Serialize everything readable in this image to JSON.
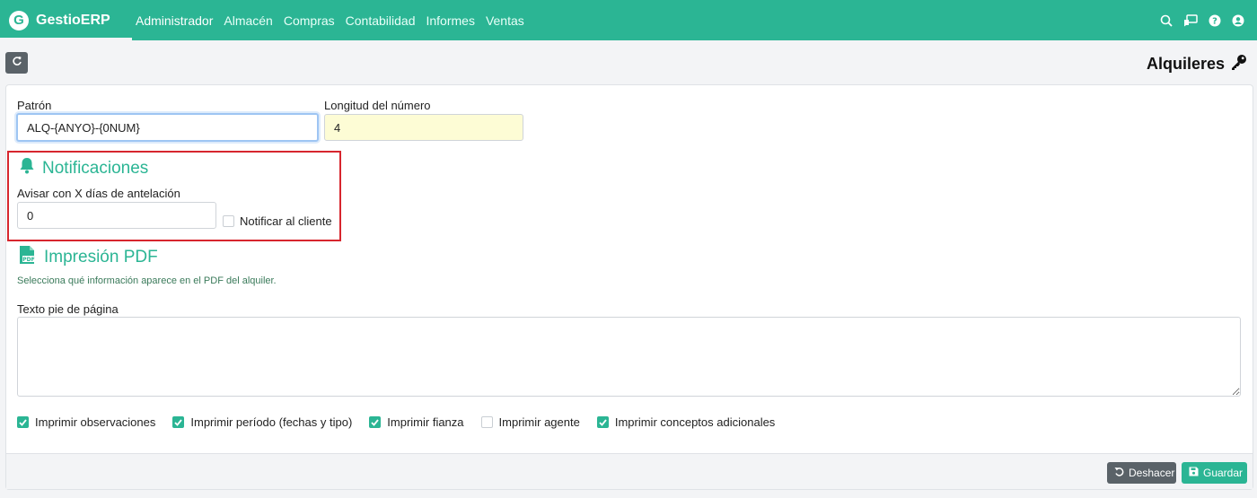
{
  "navbar": {
    "brand_initial": "G",
    "brand_name": "GestioERP",
    "menu": [
      "Administrador",
      "Almacén",
      "Compras",
      "Contabilidad",
      "Informes",
      "Ventas"
    ],
    "active": "Administrador",
    "icons": [
      "search-icon",
      "chat-icon",
      "help-icon",
      "user-icon"
    ],
    "color": "#2bb594"
  },
  "toolbar": {
    "refresh_icon": "refresh-icon",
    "title": "Alquileres",
    "title_icon": "key-icon"
  },
  "form": {
    "pattern_label": "Patrón",
    "pattern_value": "ALQ-{ANYO}-{0NUM}",
    "number_length_label": "Longitud del número",
    "number_length_value": "4"
  },
  "notifications": {
    "title": "Notificaciones",
    "icon": "bell-icon",
    "days_label": "Avisar con X días de antelación",
    "days_value": "0",
    "notify_client_label": "Notificar al cliente",
    "notify_client_checked": false
  },
  "pdf": {
    "title": "Impresión PDF",
    "icon": "pdf-file-icon",
    "hint": "Selecciona qué información aparece en el PDF del alquiler.",
    "footer_label": "Texto pie de página",
    "footer_value": "",
    "options": [
      {
        "label": "Imprimir observaciones",
        "checked": true
      },
      {
        "label": "Imprimir período (fechas y tipo)",
        "checked": true
      },
      {
        "label": "Imprimir fianza",
        "checked": true
      },
      {
        "label": "Imprimir agente",
        "checked": false
      },
      {
        "label": "Imprimir conceptos adicionales",
        "checked": true
      }
    ]
  },
  "footer": {
    "undo_label": "Deshacer",
    "save_label": "Guardar"
  }
}
